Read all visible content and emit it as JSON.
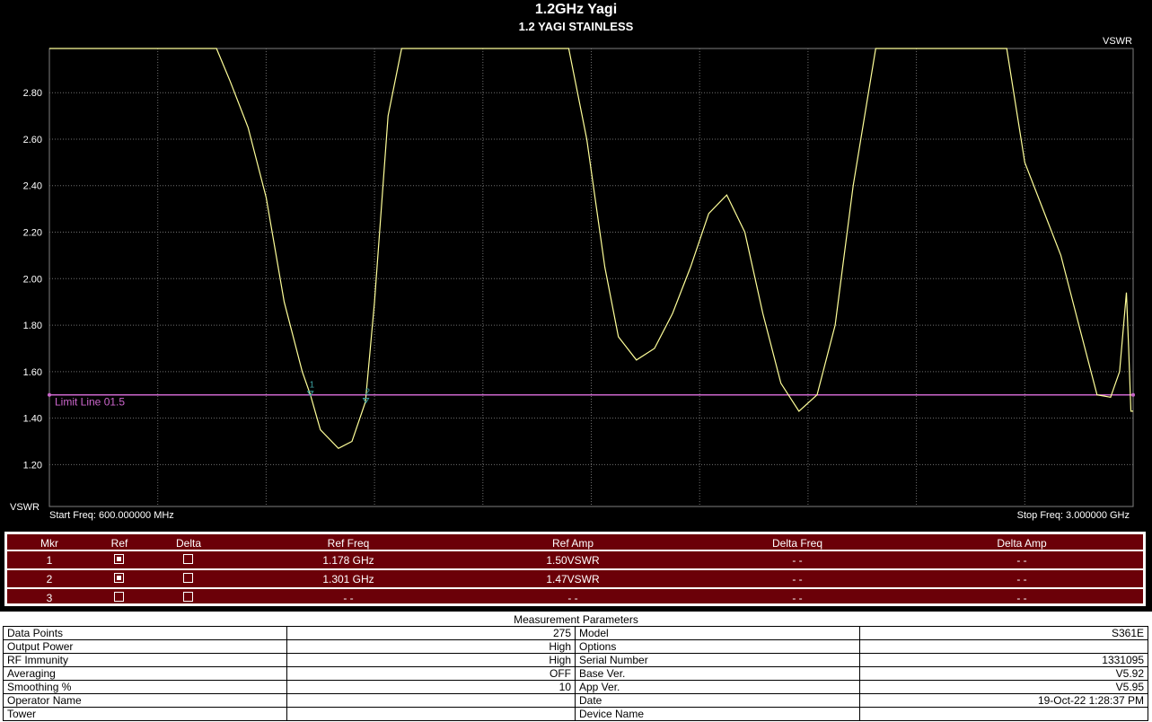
{
  "header": {
    "title": "1.2GHz Yagi",
    "subtitle": "1.2 YAGI  STAINLESS"
  },
  "chart_data": {
    "type": "line",
    "ylabel_top": "VSWR",
    "ylabel_bottom": "VSWR",
    "start_label": "Start Freq: 600.000000 MHz",
    "stop_label": "Stop Freq: 3.000000 GHz",
    "xlim": [
      0.6,
      3.0
    ],
    "ylim": [
      1.02,
      2.99
    ],
    "yticks": [
      "2.80",
      "2.60",
      "2.40",
      "2.20",
      "2.00",
      "1.80",
      "1.60",
      "1.40",
      "1.20"
    ],
    "ytick_values": [
      2.8,
      2.6,
      2.4,
      2.2,
      2.0,
      1.8,
      1.6,
      1.4,
      1.2
    ],
    "grid": true,
    "colors": {
      "trace": "#ffff99",
      "limit": "#cc66cc",
      "grid": "#707070",
      "marker": "#3ca0a0"
    },
    "limit_line": {
      "label": "Limit Line 01.5",
      "value": 1.5
    },
    "markers": [
      {
        "label": "1",
        "x": 1.178,
        "y": 1.5
      },
      {
        "label": "2",
        "x": 1.301,
        "y": 1.47
      }
    ],
    "series": [
      {
        "x": [
          0.6,
          0.97,
          1.0,
          1.04,
          1.08,
          1.12,
          1.16,
          1.178,
          1.2,
          1.24,
          1.27,
          1.3,
          1.32,
          1.35,
          1.38,
          1.75,
          1.79,
          1.83,
          1.86,
          1.9,
          1.94,
          1.98,
          2.02,
          2.06,
          2.1,
          2.14,
          2.18,
          2.22,
          2.26,
          2.3,
          2.34,
          2.38,
          2.43,
          2.44,
          2.72,
          2.76,
          2.8,
          2.84,
          2.88,
          2.92,
          2.95,
          2.97,
          2.985,
          2.99,
          2.995,
          3.0
        ],
        "y": [
          2.99,
          2.99,
          2.85,
          2.65,
          2.35,
          1.9,
          1.6,
          1.5,
          1.35,
          1.27,
          1.3,
          1.47,
          1.9,
          2.7,
          2.99,
          2.99,
          2.6,
          2.05,
          1.75,
          1.65,
          1.7,
          1.85,
          2.05,
          2.28,
          2.36,
          2.2,
          1.85,
          1.55,
          1.43,
          1.5,
          1.8,
          2.4,
          2.99,
          2.99,
          2.99,
          2.5,
          2.3,
          2.1,
          1.8,
          1.5,
          1.49,
          1.6,
          1.94,
          1.7,
          1.43,
          1.43
        ]
      }
    ]
  },
  "markers_table": {
    "headers": [
      "Mkr",
      "Ref",
      "Delta",
      "Ref Freq",
      "Ref Amp",
      "Delta Freq",
      "Delta Amp"
    ],
    "rows": [
      {
        "mkr": "1",
        "ref_on": true,
        "delta_on": false,
        "ref_freq": "1.178 GHz",
        "ref_amp": "1.50VSWR",
        "delta_freq": "- -",
        "delta_amp": "- -"
      },
      {
        "mkr": "2",
        "ref_on": true,
        "delta_on": false,
        "ref_freq": "1.301 GHz",
        "ref_amp": "1.47VSWR",
        "delta_freq": "- -",
        "delta_amp": "- -"
      },
      {
        "mkr": "3",
        "ref_on": false,
        "delta_on": false,
        "ref_freq": "- -",
        "ref_amp": "- -",
        "delta_freq": "- -",
        "delta_amp": "- -"
      }
    ]
  },
  "params": {
    "title": "Measurement Parameters",
    "rows": [
      [
        "Data Points",
        "275",
        "Model",
        "S361E"
      ],
      [
        "Output Power",
        "High",
        "Options",
        ""
      ],
      [
        "RF Immunity",
        "High",
        "Serial Number",
        "1331095"
      ],
      [
        "Averaging",
        "OFF",
        "Base Ver.",
        "V5.92"
      ],
      [
        "Smoothing %",
        "10",
        "App Ver.",
        "V5.95"
      ],
      [
        "Operator Name",
        "",
        "Date",
        "19-Oct-22 1:28:37 PM"
      ],
      [
        "Tower",
        "",
        "Device Name",
        ""
      ]
    ]
  }
}
